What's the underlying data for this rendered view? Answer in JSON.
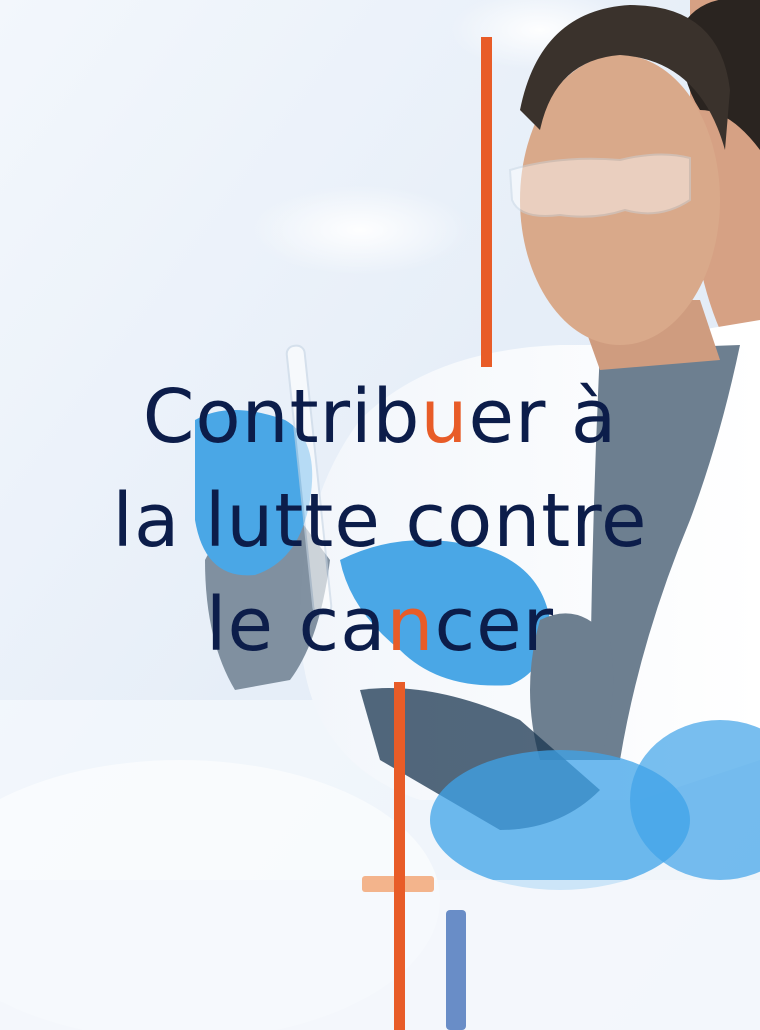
{
  "headline": {
    "line1": {
      "before": "Contrib",
      "accent": "u",
      "after": "er à"
    },
    "line2": "la lutte contre",
    "line3": {
      "before": "le ca",
      "accent": "n",
      "after": "cer"
    }
  },
  "colors": {
    "text": "#0c1d4a",
    "accent": "#e85c28",
    "background": "#eef4fb",
    "coat": "#ffffff",
    "glove": "#4aa7e6",
    "shirt": "#6d7f90",
    "skin": "#d9a98a",
    "hair": "#2a2420"
  }
}
